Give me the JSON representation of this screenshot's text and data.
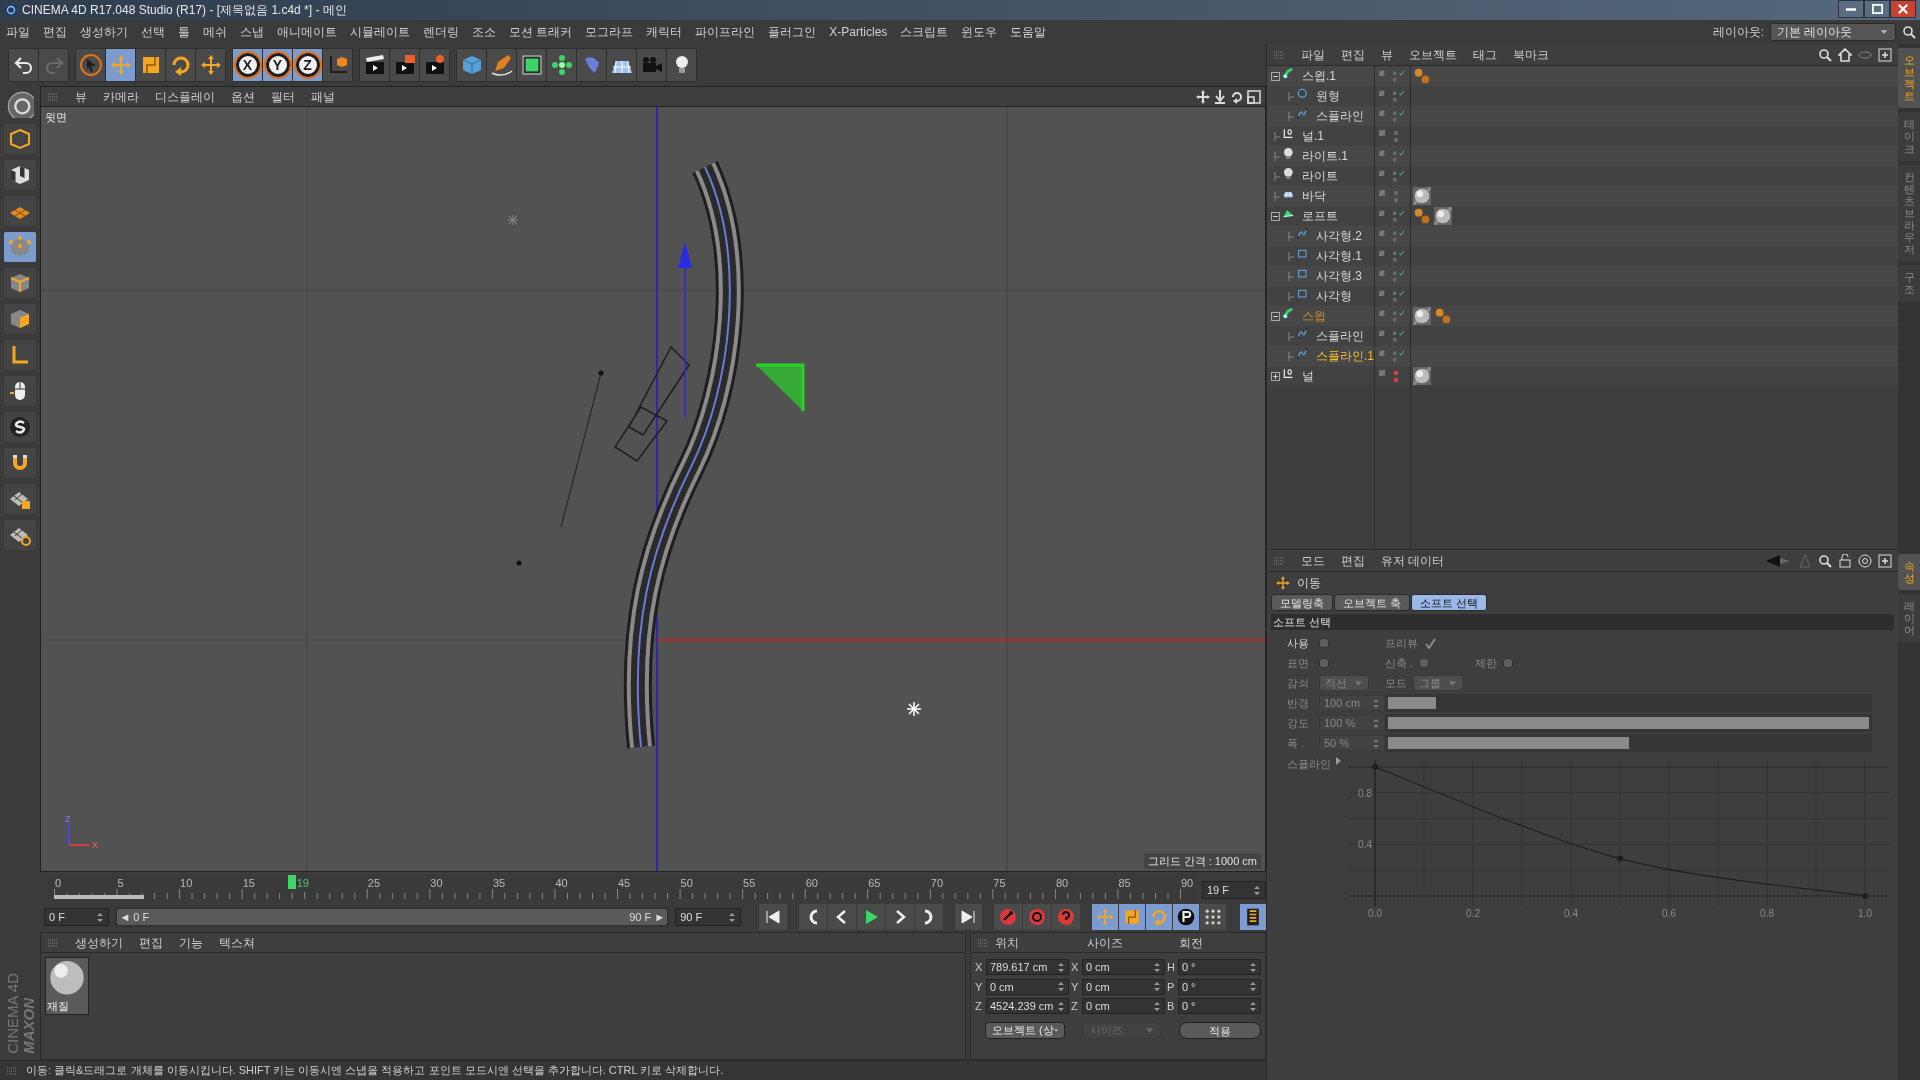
{
  "window": {
    "title": "CINEMA 4D R17.048 Studio (R17) - [제목없음 1.c4d *] - 메인"
  },
  "menu": [
    "파일",
    "편집",
    "생성하기",
    "선택",
    "툴",
    "메쉬",
    "스냅",
    "애니메이트",
    "시뮬레이트",
    "렌더링",
    "조소",
    "모션 트래커",
    "모그라프",
    "캐릭터",
    "파이프라인",
    "플러그인",
    "X-Particles",
    "스크립트",
    "윈도우",
    "도움말"
  ],
  "layout": {
    "label": "레이아웃:",
    "value": "기본 레이아웃"
  },
  "toolbar": [
    [
      {
        "kind": "undo",
        "selected": false
      },
      {
        "kind": "redo",
        "selected": false
      }
    ],
    [
      {
        "kind": "select",
        "selected": false
      },
      {
        "kind": "move",
        "selected": true
      },
      {
        "kind": "scale",
        "selected": false
      },
      {
        "kind": "rotate",
        "selected": false
      },
      {
        "kind": "recent",
        "selected": false
      }
    ],
    [
      {
        "kind": "axis",
        "label": "X",
        "selected": true
      },
      {
        "kind": "axis",
        "label": "Y",
        "selected": true
      },
      {
        "kind": "axis",
        "label": "Z",
        "selected": true
      },
      {
        "kind": "coord",
        "selected": false
      }
    ],
    [
      {
        "kind": "render-view",
        "selected": false
      },
      {
        "kind": "render",
        "selected": false
      },
      {
        "kind": "render-settings",
        "selected": false
      }
    ],
    [
      {
        "kind": "cube",
        "selected": false
      },
      {
        "kind": "pen",
        "selected": false
      },
      {
        "kind": "subdivide",
        "selected": false
      },
      {
        "kind": "cloner",
        "selected": false
      },
      {
        "kind": "deformer",
        "selected": false
      },
      {
        "kind": "floor",
        "selected": false
      },
      {
        "kind": "camera",
        "selected": false
      },
      {
        "kind": "light",
        "selected": false
      }
    ]
  ],
  "left_tools": [
    {
      "kind": "model",
      "selected": false
    },
    {
      "kind": "texture",
      "selected": false
    },
    {
      "kind": "workplane",
      "selected": false
    },
    {
      "kind": "points",
      "selected": true
    },
    {
      "kind": "edges",
      "selected": false
    },
    {
      "kind": "polygons",
      "selected": false
    },
    {
      "kind": "axis",
      "selected": false
    },
    {
      "kind": "tweak",
      "selected": false
    },
    {
      "kind": "snap",
      "selected": false
    },
    {
      "kind": "magnet",
      "selected": false
    },
    {
      "kind": "grid-lock",
      "selected": false
    },
    {
      "kind": "grid-snap",
      "selected": false
    }
  ],
  "brand": {
    "line_1": "MAXON",
    "line_2": "CINEMA 4D"
  },
  "viewport": {
    "menu": [
      "뷰",
      "카메라",
      "디스플레이",
      "옵션",
      "필터",
      "패널"
    ],
    "view_name": "윗면",
    "grid_spacing": "그리드 간격 : 1000 cm",
    "gizmo": {
      "vertical": "Z",
      "horizontal": "X"
    }
  },
  "timeline": {
    "ticks": [
      "0",
      "5",
      "10",
      "15",
      "25",
      "30",
      "35",
      "40",
      "45",
      "50",
      "55",
      "60",
      "65",
      "70",
      "75",
      "80",
      "85",
      "90"
    ],
    "playhead": {
      "label": "19",
      "level": 0.2111
    },
    "current_field": "19 F",
    "start_field": "0 F",
    "range": {
      "left_arrow": "◄",
      "start": "0 F",
      "end": "90 F",
      "right_arrow": "►",
      "level": 1
    },
    "end_field": "90 F"
  },
  "material_manager": {
    "menu": [
      "생성하기",
      "편집",
      "기능",
      "텍스쳐"
    ],
    "materials": [
      {
        "name": "재질"
      }
    ]
  },
  "coordinates": {
    "headers": [
      "위치",
      "사이즈",
      "회전"
    ],
    "rows": [
      {
        "p_axis": "X",
        "position": "789.617 cm",
        "s_axis": "X",
        "size": "0 cm",
        "r_axis": "H",
        "rotation": "0 °"
      },
      {
        "p_axis": "Y",
        "position": "0 cm",
        "s_axis": "Y",
        "size": "0 cm",
        "r_axis": "P",
        "rotation": "0 °"
      },
      {
        "p_axis": "Z",
        "position": "4524.239 cm",
        "s_axis": "Z",
        "size": "0 cm",
        "r_axis": "B",
        "rotation": "0 °"
      }
    ],
    "mode_dropdown": {
      "value": "오브젝트 (상",
      "disabled": false
    },
    "size_dropdown": {
      "value": "사이즈",
      "disabled": true
    },
    "apply_button": "적용"
  },
  "status_bar": "이동: 클릭&드래그로 개체를 이동시킵니다. SHIFT 키는 이동시엔 스냅을 적용하고 포인트 모드시엔 선택을 추가합니다. CTRL 키로 삭제합니다.",
  "object_manager": {
    "menu": [
      "파일",
      "편집",
      "뷰",
      "오브젝트",
      "태그",
      "북마크"
    ],
    "objects": [
      {
        "name": "스윕.1",
        "kind": "sweep",
        "expanded": true,
        "selected": false,
        "active": false,
        "enabled": true,
        "render_off": false,
        "tags": [
          {
            "kind": "phong"
          }
        ],
        "children": [
          {
            "name": "원형",
            "kind": "circle",
            "selected": false,
            "active": false,
            "enabled": true,
            "render_off": false
          },
          {
            "name": "스플라인",
            "kind": "spline",
            "selected": false,
            "active": false,
            "enabled": true,
            "render_off": false
          }
        ]
      },
      {
        "name": "널.1",
        "kind": "null",
        "selected": false,
        "active": false,
        "enabled": false,
        "render_off": false
      },
      {
        "name": "라이트.1",
        "kind": "light",
        "selected": false,
        "active": false,
        "enabled": true,
        "render_off": false
      },
      {
        "name": "라이트",
        "kind": "light",
        "selected": false,
        "active": false,
        "enabled": true,
        "render_off": false
      },
      {
        "name": "바닥",
        "kind": "floor",
        "selected": false,
        "active": false,
        "enabled": false,
        "render_off": false,
        "tags": [
          {
            "kind": "material"
          }
        ]
      },
      {
        "name": "로프트",
        "kind": "loft",
        "expanded": true,
        "selected": false,
        "active": false,
        "enabled": true,
        "render_off": false,
        "tags": [
          {
            "kind": "phong"
          },
          {
            "kind": "material"
          }
        ],
        "children": [
          {
            "name": "사각형.2",
            "kind": "spline",
            "selected": false,
            "active": false,
            "enabled": true,
            "render_off": false
          },
          {
            "name": "사각형.1",
            "kind": "rectangle",
            "selected": false,
            "active": false,
            "enabled": true,
            "render_off": false
          },
          {
            "name": "사각형.3",
            "kind": "rectangle",
            "selected": false,
            "active": false,
            "enabled": true,
            "render_off": false
          },
          {
            "name": "사각형",
            "kind": "rectangle",
            "selected": false,
            "active": false,
            "enabled": true,
            "render_off": false
          }
        ]
      },
      {
        "name": "스윕",
        "kind": "sweep",
        "expanded": true,
        "selected": true,
        "active": false,
        "enabled": true,
        "render_off": false,
        "tags": [
          {
            "kind": "material"
          },
          {
            "kind": "phong"
          }
        ],
        "children": [
          {
            "name": "스플라인",
            "kind": "spline",
            "selected": false,
            "active": false,
            "enabled": true,
            "render_off": false
          },
          {
            "name": "스플라인.1",
            "kind": "spline",
            "selected": true,
            "active": true,
            "enabled": true,
            "render_off": false
          }
        ]
      },
      {
        "name": "널",
        "kind": "null",
        "expanded": false,
        "selected": false,
        "active": false,
        "enabled": false,
        "render_off": true,
        "tags": [
          {
            "kind": "material"
          }
        ]
      }
    ]
  },
  "object_side_tabs": [
    {
      "label": "오브젝트",
      "selected": true
    },
    {
      "label": "테이크",
      "selected": false
    },
    {
      "label": "컨텐츠 브라우저",
      "selected": false
    },
    {
      "label": "구조",
      "selected": false
    }
  ],
  "attributes": {
    "menu": [
      "모드",
      "편집",
      "유저 데이터"
    ],
    "tool": "이동",
    "tabs": [
      {
        "label": "모델링축",
        "selected": false
      },
      {
        "label": "오브젝트 축",
        "selected": false
      },
      {
        "label": "소프트 선택",
        "selected": true
      }
    ],
    "section": "소프트 선택",
    "rows": [
      [
        {
          "kind": "checkbox",
          "label": "사용",
          "checked": false,
          "disabled": false
        },
        {
          "kind": "checkbox",
          "label": "프리뷰",
          "checked": true,
          "disabled": true
        }
      ],
      [
        {
          "kind": "checkbox",
          "label": "표면",
          "checked": false,
          "disabled": true
        },
        {
          "kind": "checkbox",
          "label": "신축 .",
          "checked": false,
          "disabled": true
        },
        {
          "kind": "checkbox",
          "label": "제한",
          "checked": false,
          "disabled": true
        }
      ],
      [
        {
          "kind": "dropdown",
          "label": "감쇠",
          "value": "직선",
          "disabled": true
        },
        {
          "kind": "dropdown",
          "label": "모드",
          "value": "그룹",
          "disabled": true
        }
      ],
      [
        {
          "kind": "slider",
          "label": "반경",
          "value": "100 cm",
          "level": 0.1,
          "disabled": true
        }
      ],
      [
        {
          "kind": "slider",
          "label": "강도",
          "value": "100 %",
          "level": 1.0,
          "disabled": true
        }
      ],
      [
        {
          "kind": "slider",
          "label": "폭 .",
          "value": "50 %",
          "level": 0.5,
          "disabled": true
        }
      ]
    ],
    "chart_data": {
      "type": "line",
      "grid": true,
      "x": [
        0,
        0.5,
        1
      ],
      "series": [
        {
          "name": "스플라인",
          "color": "#1e1e1e",
          "marker": "circle",
          "values": [
            1,
            0.29,
            0
          ]
        }
      ],
      "xlim": [
        0,
        1
      ],
      "ylim": [
        0,
        1
      ],
      "xticks": [
        {
          "value": 0,
          "label": "0.0"
        },
        {
          "value": 0.2,
          "label": "0.2"
        },
        {
          "value": 0.4,
          "label": "0.4"
        },
        {
          "value": 0.6,
          "label": "0.6"
        },
        {
          "value": 0.8,
          "label": "0.8"
        },
        {
          "value": 1,
          "label": "1.0"
        }
      ],
      "yticks": [
        0.4,
        0.8
      ]
    }
  },
  "attribute_side_tabs": [
    {
      "label": "속성",
      "selected": true
    },
    {
      "label": "레이어",
      "selected": false
    }
  ]
}
